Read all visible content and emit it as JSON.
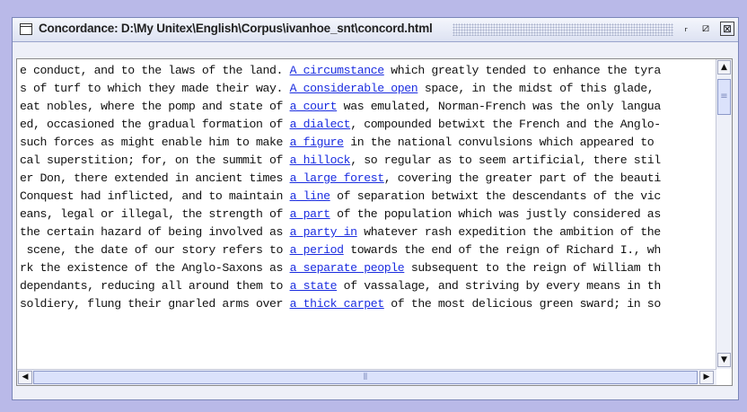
{
  "window": {
    "title": "Concordance: D:\\My Unitex\\English\\Corpus\\ivanhoe_snt\\concord.html",
    "min_glyph": "ᵣ",
    "max_glyph": "⧄",
    "close_glyph": "⊠"
  },
  "scroll": {
    "up_glyph": "▲",
    "down_glyph": "▼",
    "left_glyph": "◀",
    "right_glyph": "▶",
    "v_grip": "≡",
    "h_grip": "⦀"
  },
  "concordance": [
    {
      "left": "e conduct, and to the laws of the land. ",
      "match": "A circumstance",
      "right": " which greatly tended to enhance the tyra"
    },
    {
      "left": "s of turf to which they made their way. ",
      "match": "A considerable open",
      "right": " space, in the midst of this glade,"
    },
    {
      "left": "eat nobles, where the pomp and state of ",
      "match": "a court",
      "right": " was emulated, Norman-French was the only langua"
    },
    {
      "left": "ed, occasioned the gradual formation of ",
      "match": "a dialect",
      "right": ", compounded betwixt the French and the Anglo-"
    },
    {
      "left": "such forces as might enable him to make ",
      "match": "a figure",
      "right": " in the national convulsions which appeared to"
    },
    {
      "left": "cal superstition; for, on the summit of ",
      "match": "a hillock",
      "right": ", so regular as to seem artificial, there stil"
    },
    {
      "left": "er Don, there extended in ancient times ",
      "match": "a large forest",
      "right": ", covering the greater part of the beauti"
    },
    {
      "left": "Conquest had inflicted, and to maintain ",
      "match": "a line",
      "right": " of separation betwixt the descendants of the vic"
    },
    {
      "left": "eans, legal or illegal, the strength of ",
      "match": "a part",
      "right": " of the population which was justly considered as"
    },
    {
      "left": "the certain hazard of being involved as ",
      "match": "a party in",
      "right": " whatever rash expedition the ambition of the"
    },
    {
      "left": " scene, the date of our story refers to ",
      "match": "a period",
      "right": " towards the end of the reign of Richard I., wh"
    },
    {
      "left": "rk the existence of the Anglo-Saxons as ",
      "match": "a separate people",
      "right": " subsequent to the reign of William th"
    },
    {
      "left": "dependants, reducing all around them to ",
      "match": "a state",
      "right": " of vassalage, and striving by every means in th"
    },
    {
      "left": "soldiery, flung their gnarled arms over ",
      "match": "a thick carpet",
      "right": " of the most delicious green sward; in so"
    }
  ]
}
